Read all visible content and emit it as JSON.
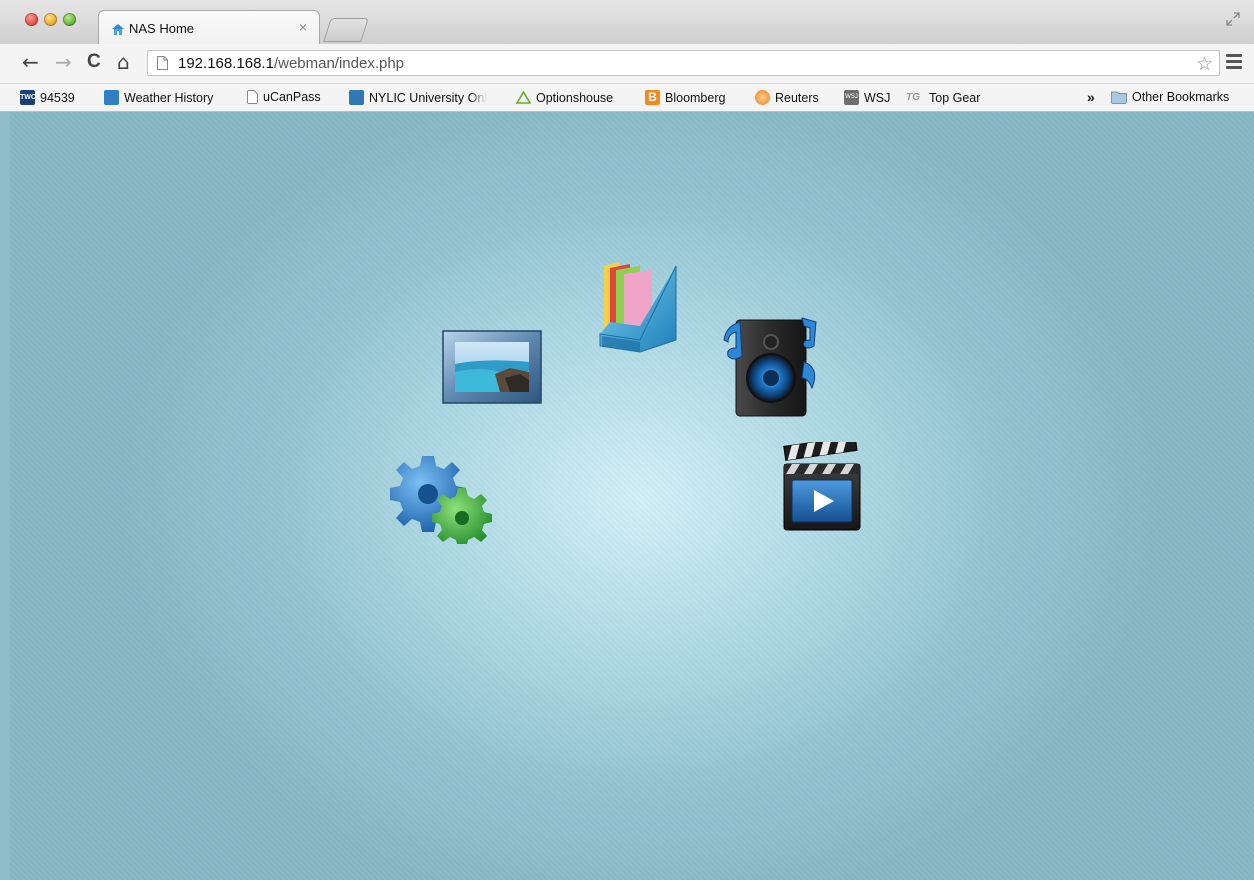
{
  "browser": {
    "tab": {
      "title": "NAS Home",
      "close": "×"
    },
    "url": {
      "host": "192.168.168.1",
      "path": "/webman/index.php"
    },
    "nav": {
      "back": "←",
      "forward": "→",
      "reload": "C",
      "home": "⌂",
      "star": "☆"
    },
    "bookmarks": [
      {
        "label": "94539",
        "icon": "twc-icon",
        "color": "#1c3f7a"
      },
      {
        "label": "Weather History",
        "icon": "weather-icon",
        "color": "#2f7fc1"
      },
      {
        "label": "uCanPass",
        "icon": "page-icon",
        "color": "#ffffff"
      },
      {
        "label": "NYLIC University Onl",
        "icon": "nylic-icon",
        "color": "#2e78b8"
      },
      {
        "label": "Optionshouse",
        "icon": "triangle-icon",
        "color": "#6aab2e"
      },
      {
        "label": "Bloomberg",
        "icon": "bloomberg-icon",
        "color": "#f28a1e"
      },
      {
        "label": "Reuters",
        "icon": "reuters-icon",
        "color": "#f07d1b"
      },
      {
        "label": "WSJ",
        "icon": "wsj-icon",
        "color": "#6d6d6d"
      },
      {
        "label": "Top Gear",
        "icon": "topgear-icon",
        "color": "#9a9a9a"
      }
    ],
    "overflow": "»",
    "other_bookmarks": "Other Bookmarks"
  },
  "apps": [
    {
      "name": "photo-station-icon"
    },
    {
      "name": "file-station-icon"
    },
    {
      "name": "audio-station-icon"
    },
    {
      "name": "control-panel-icon"
    },
    {
      "name": "video-station-icon"
    }
  ]
}
